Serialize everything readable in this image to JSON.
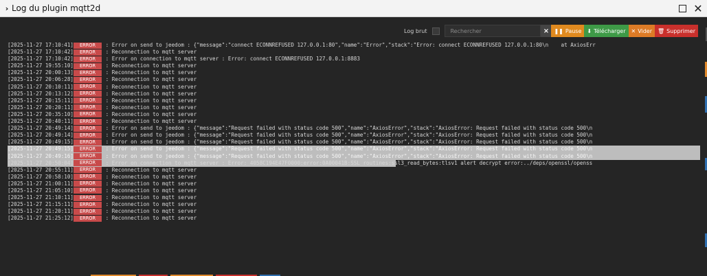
{
  "window": {
    "title": "Log du plugin mqtt2d",
    "chevron": "›"
  },
  "toolbar": {
    "raw_label": "Log brut",
    "search_placeholder": "Rechercher",
    "clear_search": "×",
    "pause_icon": "❚❚",
    "pause_label": "Pause",
    "download_icon": "⬇",
    "download_label": "Télécharger",
    "empty_icon": "✕",
    "empty_label": "Vider",
    "delete_icon": "🗑",
    "delete_label": "Supprimer"
  },
  "colors": {
    "error_badge": "#c84a4a",
    "pause": "#e08a1f",
    "download": "#3e9a47",
    "empty": "#dd7b26",
    "delete": "#c9302c"
  },
  "log": [
    {
      "ts": "[2025-11-27 17:10:41]",
      "level": "ERROR",
      "msg": "Error on send to jeedom : {\"message\":\"connect ECONNREFUSED 127.0.0.1:80\",\"name\":\"Error\",\"stack\":\"Error: connect ECONNREFUSED 127.0.0.1:80\\n    at AxiosErr",
      "state": ""
    },
    {
      "ts": "[2025-11-27 17:10:42]",
      "level": "ERROR",
      "msg": "Reconnection to mqtt server",
      "state": ""
    },
    {
      "ts": "[2025-11-27 17:10:42]",
      "level": "ERROR",
      "msg": "Error on connection to mqtt server : Error: connect ECONNREFUSED 127.0.0.1:8883",
      "state": ""
    },
    {
      "ts": "[2025-11-27 19:55:10]",
      "level": "ERROR",
      "msg": "Reconnection to mqtt server",
      "state": ""
    },
    {
      "ts": "[2025-11-27 20:00:13]",
      "level": "ERROR",
      "msg": "Reconnection to mqtt server",
      "state": ""
    },
    {
      "ts": "[2025-11-27 20:06:28]",
      "level": "ERROR",
      "msg": "Reconnection to mqtt server",
      "state": ""
    },
    {
      "ts": "[2025-11-27 20:10:11]",
      "level": "ERROR",
      "msg": "Reconnection to mqtt server",
      "state": ""
    },
    {
      "ts": "[2025-11-27 20:13:12]",
      "level": "ERROR",
      "msg": "Reconnection to mqtt server",
      "state": ""
    },
    {
      "ts": "[2025-11-27 20:15:11]",
      "level": "ERROR",
      "msg": "Reconnection to mqtt server",
      "state": ""
    },
    {
      "ts": "[2025-11-27 20:20:11]",
      "level": "ERROR",
      "msg": "Reconnection to mqtt server",
      "state": ""
    },
    {
      "ts": "[2025-11-27 20:35:10]",
      "level": "ERROR",
      "msg": "Reconnection to mqtt server",
      "state": ""
    },
    {
      "ts": "[2025-11-27 20:40:11]",
      "level": "ERROR",
      "msg": "Reconnection to mqtt server",
      "state": ""
    },
    {
      "ts": "[2025-11-27 20:49:14]",
      "level": "ERROR",
      "msg": "Error on send to jeedom : {\"message\":\"Request failed with status code 500\",\"name\":\"AxiosError\",\"stack\":\"AxiosError: Request failed with status code 500\\n",
      "state": ""
    },
    {
      "ts": "[2025-11-27 20:49:14]",
      "level": "ERROR",
      "msg": "Error on send to jeedom : {\"message\":\"Request failed with status code 500\",\"name\":\"AxiosError\",\"stack\":\"AxiosError: Request failed with status code 500\\n",
      "state": ""
    },
    {
      "ts": "[2025-11-27 20:49:15]",
      "level": "ERROR",
      "msg": "Error on send to jeedom : {\"message\":\"Request failed with status code 500\",\"name\":\"AxiosError\",\"stack\":\"AxiosError: Request failed with status code 500\\n",
      "state": ""
    },
    {
      "ts": "[2025-11-27 20:49:15]",
      "level": "ERROR",
      "msg": "Error on send to jeedom : {\"message\":\"Request failed with status code 500\",\"name\":\"AxiosError\",\"stack\":\"AxiosError: Request failed with status code 500\\n",
      "state": "sel"
    },
    {
      "ts": "[2025-11-27 20:49:16]",
      "level": "ERROR",
      "msg": "Error on send to jeedom : {\"message\":\"Request failed with status code 500\",\"name\":\"AxiosError\",\"stack\":\"AxiosError: Request failed with status code 500\\n",
      "state": "sel"
    },
    {
      "ts": "[2025-11-27 20:50:04]",
      "level": "ERROR",
      "msg": "Error on connection to mqtt server : Error: 4058C194E47F0000:error:0A00041B:SSL routines:ssl3_read_bytes:tlsv1 alert decrypt error:../deps/openssl/openss",
      "state": "partial"
    },
    {
      "ts": "[2025-11-27 20:55:11]",
      "level": "ERROR",
      "msg": "Reconnection to mqtt server",
      "state": ""
    },
    {
      "ts": "[2025-11-27 20:58:10]",
      "level": "ERROR",
      "msg": "Reconnection to mqtt server",
      "state": ""
    },
    {
      "ts": "[2025-11-27 21:00:11]",
      "level": "ERROR",
      "msg": "Reconnection to mqtt server",
      "state": ""
    },
    {
      "ts": "[2025-11-27 21:05:10]",
      "level": "ERROR",
      "msg": "Reconnection to mqtt server",
      "state": ""
    },
    {
      "ts": "[2025-11-27 21:10:11]",
      "level": "ERROR",
      "msg": "Reconnection to mqtt server",
      "state": ""
    },
    {
      "ts": "[2025-11-27 21:15:11]",
      "level": "ERROR",
      "msg": "Reconnection to mqtt server",
      "state": ""
    },
    {
      "ts": "[2025-11-27 21:20:11]",
      "level": "ERROR",
      "msg": "Reconnection to mqtt server",
      "state": ""
    },
    {
      "ts": "[2025-11-27 21:25:12]",
      "level": "ERROR",
      "msg": "Reconnection to mqtt server",
      "state": ""
    }
  ]
}
